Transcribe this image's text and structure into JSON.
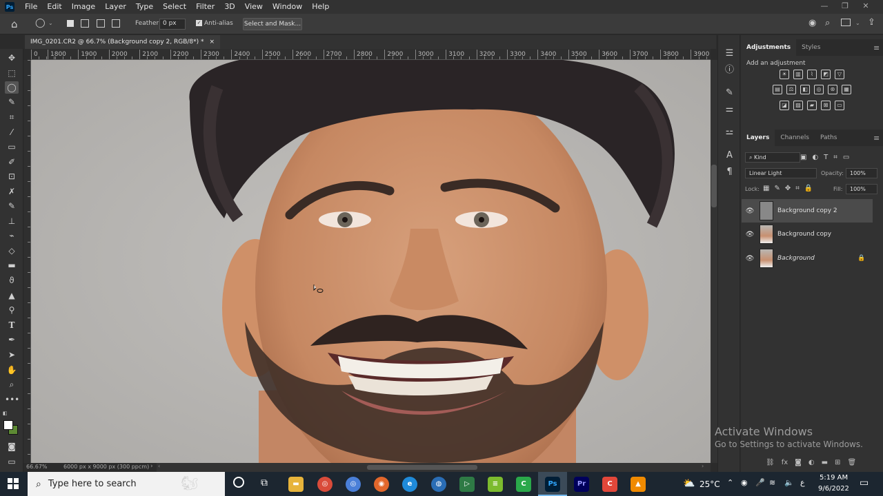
{
  "menubar": {
    "logo": "Ps",
    "items": [
      "File",
      "Edit",
      "Image",
      "Layer",
      "Type",
      "Select",
      "Filter",
      "3D",
      "View",
      "Window",
      "Help"
    ]
  },
  "options": {
    "feather_label": "Feather:",
    "feather_value": "0 px",
    "antialias_label": "Anti-alias",
    "antialias_checked": true,
    "select_mask_label": "Select and Mask..."
  },
  "document": {
    "tab_title": "IMG_0201.CR2 @ 66.7% (Background copy 2, RGB/8*) *",
    "close": "×"
  },
  "ruler": {
    "h_ticks": [
      "0",
      "1800",
      "1900",
      "2000",
      "2100",
      "2200",
      "2300",
      "2400",
      "2500",
      "2600",
      "2700",
      "2800",
      "2900",
      "3000",
      "3100",
      "3200",
      "3300",
      "3400",
      "3500",
      "3600",
      "3700",
      "3800",
      "3900"
    ]
  },
  "status": {
    "zoom": "66.67%",
    "doc_size": "6000 px x 9000 px (300 ppcm)"
  },
  "adjustments": {
    "tabs": [
      "Adjustments",
      "Styles"
    ],
    "hint": "Add an adjustment"
  },
  "layers_panel": {
    "tabs": [
      "Layers",
      "Channels",
      "Paths"
    ],
    "kind_filter": "Kind",
    "blend_mode": "Linear Light",
    "opacity_label": "Opacity:",
    "opacity_value": "100%",
    "lock_label": "Lock:",
    "fill_label": "Fill:",
    "fill_value": "100%",
    "layers": [
      {
        "name": "Background copy 2",
        "visible": true,
        "selected": true,
        "locked": false
      },
      {
        "name": "Background copy",
        "visible": true,
        "selected": false,
        "locked": false
      },
      {
        "name": "Background",
        "visible": true,
        "selected": false,
        "locked": true
      }
    ]
  },
  "watermark": {
    "title": "Activate Windows",
    "subtitle": "Go to Settings to activate Windows."
  },
  "taskbar": {
    "search_placeholder": "Type here to search",
    "weather": "25°C",
    "time": "5:19 AM",
    "date": "9/6/2022",
    "lang": "ع",
    "apps": [
      "file-explorer",
      "chrome",
      "chrome-alt",
      "firefox",
      "edge",
      "browser",
      "stack",
      "camtasia",
      "photoshop",
      "premiere",
      "camtasia-recorder",
      "vlc"
    ]
  },
  "colors": {
    "ps_accent": "#31a8ff",
    "background": "#2b2b2b",
    "canvas_bg": "#b9b7b4",
    "taskbar": "#1c2630"
  }
}
